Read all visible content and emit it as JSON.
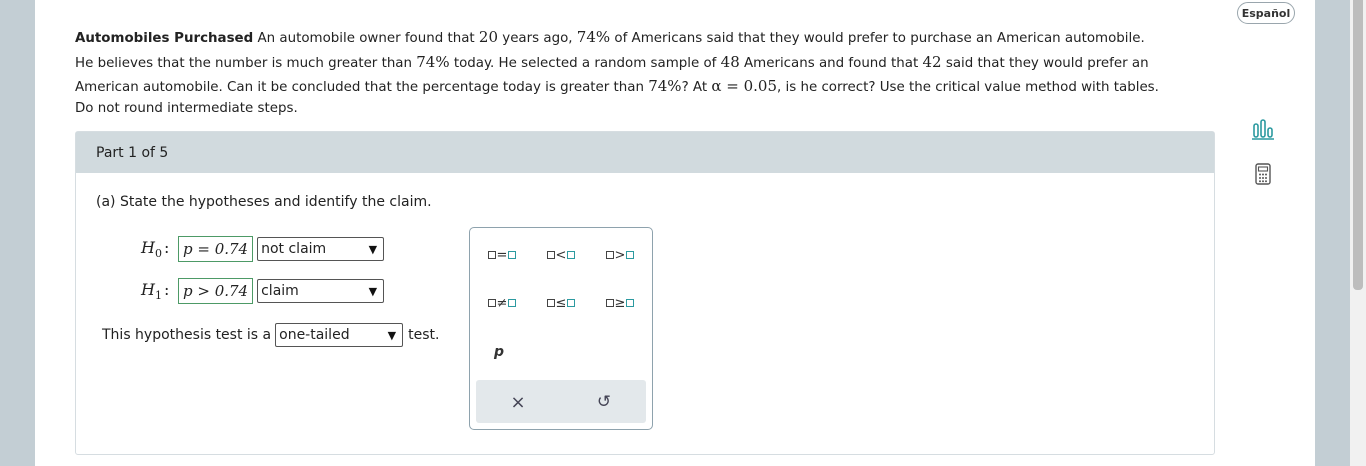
{
  "language_button": "Español",
  "problem": {
    "title": "Automobiles Purchased",
    "t1": " An automobile owner found that ",
    "years": "20",
    "t2": " years ago, ",
    "pct1": "74%",
    "t3": " of Americans said that they would prefer to purchase an American automobile.",
    "t4": "He believes that the number is much greater than ",
    "pct2": "74%",
    "t5": " today. He selected a random sample of ",
    "n": "48",
    "t6": " Americans and found that ",
    "x": "42",
    "t7": " said that they would prefer an",
    "t8": "American automobile. Can it be concluded that the percentage today is greater than ",
    "pct3": "74%",
    "t9": "? At ",
    "alpha": "α = 0.05",
    "t10": ", is he correct? Use the critical value method with tables.",
    "t11": "Do not round intermediate steps."
  },
  "part": {
    "label": "Part 1 of 5"
  },
  "question": "(a) State the hypotheses and identify the claim.",
  "h0": {
    "label_main": "H",
    "label_sub": "0",
    "colon": ":",
    "expr": "p = 0.74",
    "claim": "not claim"
  },
  "h1": {
    "label_main": "H",
    "label_sub": "1",
    "colon": ":",
    "expr": "p > 0.74",
    "claim": "claim"
  },
  "tail": {
    "prefix": "This hypothesis test is a",
    "value": "one-tailed",
    "suffix": "test."
  },
  "palette": {
    "ops": [
      "=",
      "<",
      ">",
      "≠",
      "≤",
      "≥"
    ],
    "variable": "p",
    "clear_symbol": "×",
    "undo_symbol": "↺"
  },
  "colors": {
    "accent_teal": "#2c9aa0",
    "answer_border": "#4d9a66",
    "header_bg": "#d1dade"
  },
  "icons": [
    "language-button",
    "bar-chart-icon",
    "calculator-icon",
    "dropdown-arrow-icon",
    "clear-icon",
    "undo-icon"
  ]
}
